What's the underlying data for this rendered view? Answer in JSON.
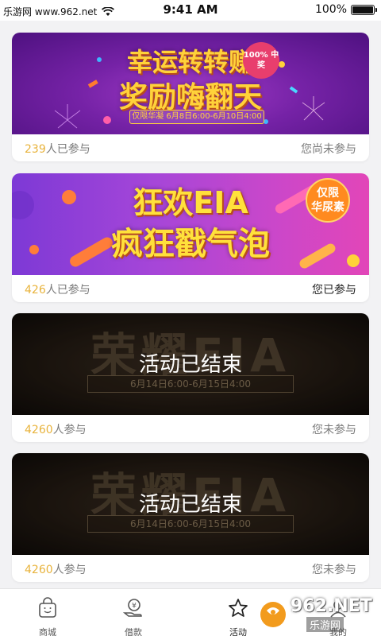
{
  "status_bar": {
    "carrier": "乐游网 www.962.net",
    "time": "9:41 AM",
    "battery_percent": "100%",
    "battery_level": 1.0
  },
  "cards": [
    {
      "banner": {
        "line1": "幸运转转赚",
        "line2": "奖励嗨翻天",
        "badge": "100% 中奖",
        "subtitle": "仅限华凝 6月8日6:00-6月10日4:00"
      },
      "count_number": "239",
      "count_suffix": "人已参与",
      "status": "您尚未参与"
    },
    {
      "banner": {
        "line1": "狂欢EIA",
        "line2": "疯狂戳气泡",
        "badge_line1": "仅限",
        "badge_line2": "华尿素"
      },
      "count_number": "426",
      "count_suffix": "人已参与",
      "status": "您已参与"
    },
    {
      "banner": {
        "bg_text": "荣耀EIA",
        "date": "6月14日6:00-6月15日4:00",
        "ended_label": "活动已结束"
      },
      "count_number": "4260",
      "count_suffix": "人参与",
      "status": "您未参与"
    },
    {
      "banner": {
        "bg_text": "荣耀EIA",
        "date": "6月14日6:00-6月15日4:00",
        "ended_label": "活动已结束"
      },
      "count_number": "4260",
      "count_suffix": "人参与",
      "status": "您未参与"
    }
  ],
  "tabs": [
    {
      "label": "商城",
      "icon": "shopping-bag-icon"
    },
    {
      "label": "借款",
      "icon": "yen-coin-hand-icon"
    },
    {
      "label": "活动",
      "icon": "star-icon",
      "active": true
    },
    {
      "label": "我的",
      "icon": "user-icon"
    }
  ],
  "watermark": {
    "text": "962.NET",
    "subtext": "乐游网"
  },
  "colors": {
    "count_highlight": "#e8b33c",
    "banner_yellow": "#ffd23a",
    "page_background": "#f2f2f4"
  }
}
